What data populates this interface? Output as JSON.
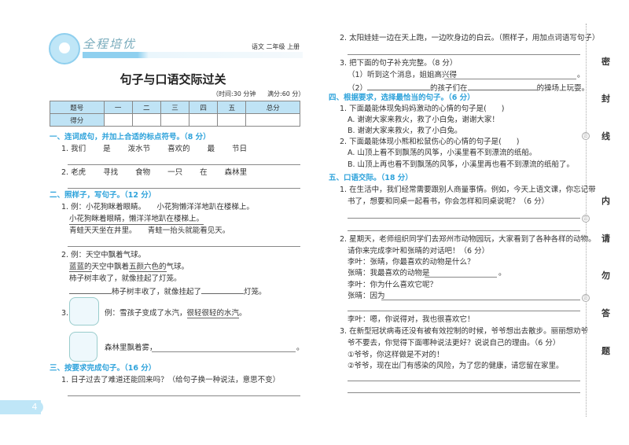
{
  "header": {
    "brand": "全程培优",
    "subject": "语文 二年级 上册",
    "title": "句子与口语交际过关",
    "time": "（时间:30 分钟",
    "full": "满分:60 分）"
  },
  "score_table": {
    "headers": [
      "题号",
      "一",
      "二",
      "三",
      "四",
      "五",
      "总分"
    ],
    "row_label": "得分"
  },
  "s1": {
    "heading": "一、连词成句，并加上合适的标点符号。（8 分）",
    "q1": [
      "1. 我们",
      "是",
      "泼水节",
      "喜欢的",
      "最",
      "节日"
    ],
    "q2": [
      "2. 老虎",
      "寻找",
      "食物",
      "一只",
      "在",
      "森林里"
    ]
  },
  "s2": {
    "heading": "二、照样子，写句子。（12 分）",
    "q1_ex": "1. 例：小花狗眯着眼睛。　　小花狗懒洋洋地趴在楼梯上。",
    "q1_ans": "小花狗眯着眼睛，懒洋洋地趴在楼梯上。",
    "q1_task": "青蛙天天坐在井里。　　青蛙一抬头就能看见天。",
    "q2_ex": "2. 例：天空中飘着气球。",
    "q2_ans_a": "蓝蓝的",
    "q2_ans_b": "天空中飘着",
    "q2_ans_c": "五颜六色的",
    "q2_ans_d": "气球。",
    "q2_task": "柿子树丰收了，就像挂起了灯笼。",
    "q2_fill_a": "柿子树丰收了，就像挂起了",
    "q2_fill_b": "灯笼。",
    "q3_num": "3.",
    "q3_ex_a": "例：雪孩子变成了水汽，",
    "q3_ex_b": "很轻很轻的水汽",
    "q3_ex_c": "。",
    "q3_task": "森林里飘着雾，",
    "q3_end": "。"
  },
  "s3": {
    "heading": "三、按要求完成句子。（16 分）",
    "q1": "1. 日子过去了难道还能回来吗？（给句子换一种说法，意思不变）",
    "q2": "2. 太阳娃娃一边在天上跑，一边吹身边的白云。（照样子，用加点词语写句子）",
    "q3": "3. 把下面的句子补充完整。（8 分）",
    "q3_1": "（1）听到这个消息，姐姐高兴得",
    "q3_2a": "（2）",
    "q3_2b": "的孩子们在",
    "q3_2c": "的操场上玩耍。",
    "period": "。"
  },
  "s4": {
    "heading": "四、根据要求，选择最恰当的句子。（6 分）",
    "q1": "1. 下面最能体现兔妈妈激动的心情的句子是(　　)",
    "q1a": "A. 谢谢大家来救火，救了小白兔，谢谢大家！",
    "q1b": "B. 谢谢大家来救火，救了小白兔。",
    "q2": "2. 下面最能体现小熊和松鼠伤心的心情的句子是(　　)",
    "q2a": "A. 山顶上看不到飘荡的风筝，小溪里看不到漂流的纸船。",
    "q2b": "B. 山顶上再也看不到飘荡的风筝，小溪里再也看不到漂流的纸船了。"
  },
  "s5": {
    "heading": "五、口语交际。（18 分）",
    "q1a": "1. 在生活中，我们经常需要跟别人商量事情。例如，今天上语文课，你忘记带",
    "q1b": "书了，想要和同桌一起看书，你会怎样和同桌说呢？（6 分）",
    "q2a": "2. 星期天，老师组织同学们去郑州市动物园玩，大家看到了各种各样的动物。",
    "q2b": "请你来完成李叶和张晴的对话吧！（6 分）",
    "d1": "李叶：张晴，你最喜欢的动物是什么？",
    "d2": "张晴：我最喜欢的动物是",
    "d2end": "。",
    "d3": "李叶：你为什么喜欢它呢？",
    "d4": "张晴：因为",
    "d5": "李叶：嗯，你说得对，我也很喜欢它！",
    "q3a": "3. 在新型冠状病毒还没有被有效控制的时候，爷爷想出去散步。丽丽想劝爷",
    "q3b": "爷不要去，你觉得下面哪种说法更好？说说自己的理由。（6 分）",
    "o1": "①爷爷，你这样做是不对的！",
    "o2": "②爷爷，现在出门有感染的风险，为了您的健康，请您留在家里。"
  },
  "side": [
    "密",
    "封",
    "线",
    "内",
    "请",
    "勿",
    "答",
    "题"
  ],
  "marker": "㊣",
  "page_number": "4"
}
